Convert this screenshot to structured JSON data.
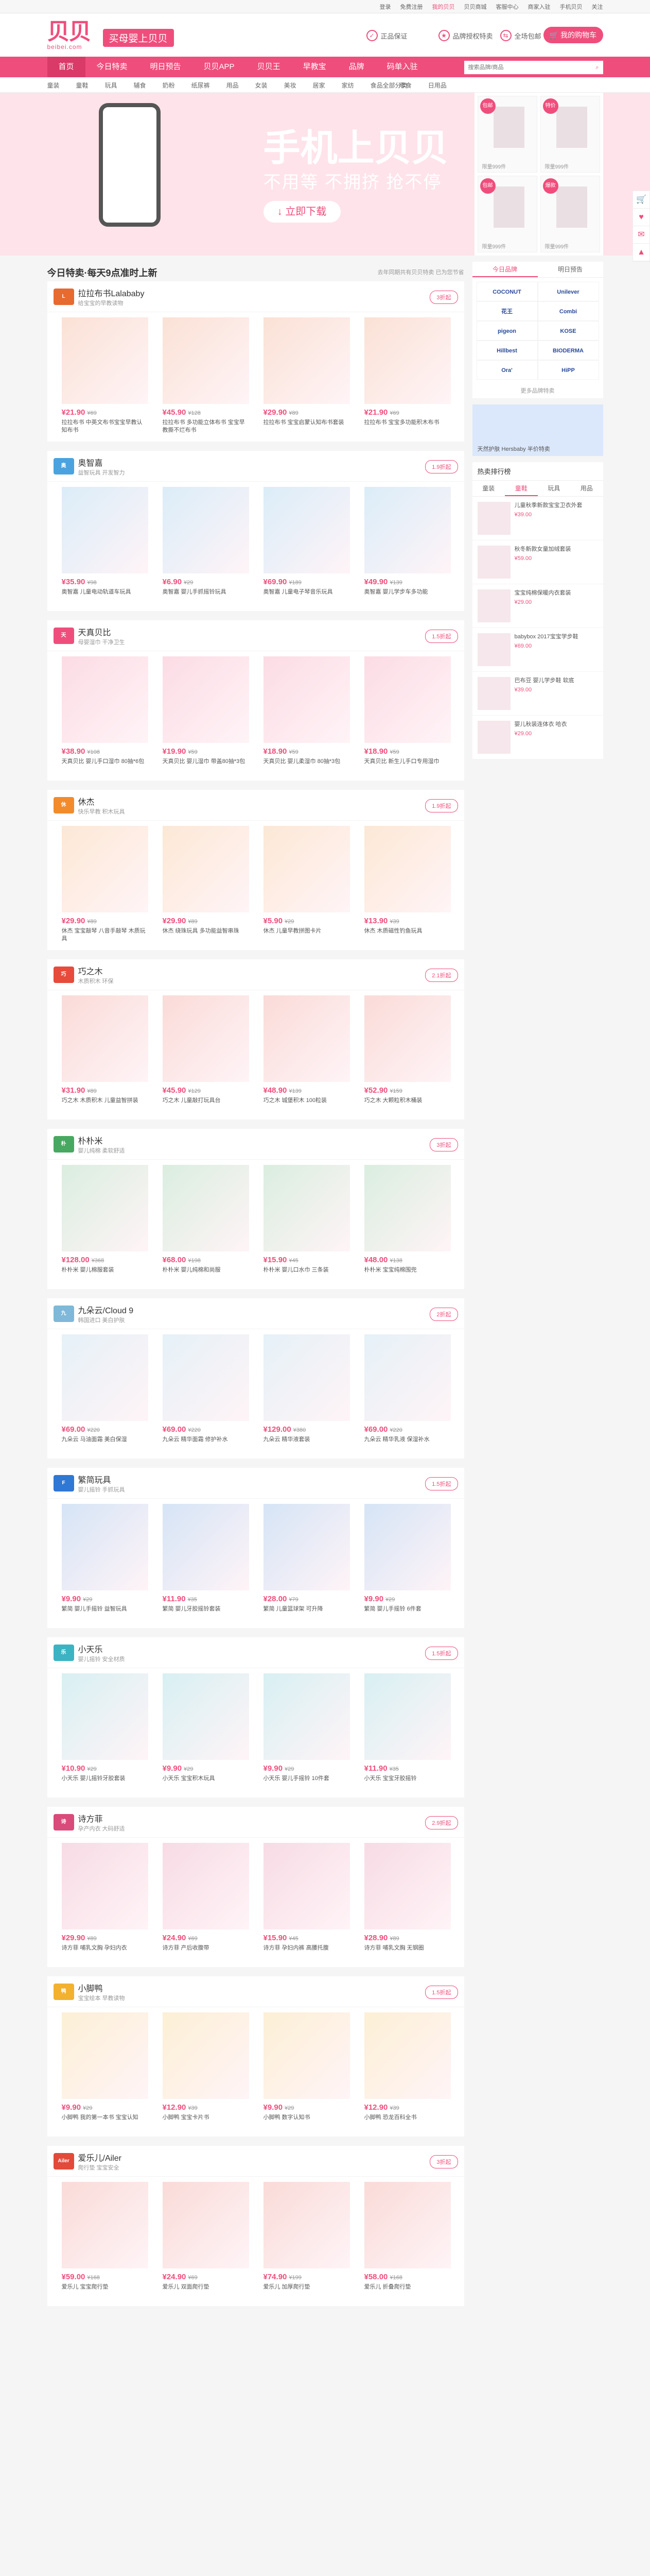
{
  "topbar": {
    "links": [
      "登录",
      "免费注册",
      "我的贝贝",
      "贝贝商城",
      "客服中心",
      "商家入驻",
      "手机贝贝",
      "关注"
    ]
  },
  "header": {
    "logo_text": "贝贝",
    "logo_sub": "beibei.com",
    "slogan": "买母婴上贝贝",
    "guarantees": [
      "正品保证",
      "品牌授权特卖",
      "全场包邮"
    ],
    "cart": "我的购物车",
    "cart_icon": "cart-icon"
  },
  "nav": {
    "items": [
      "首页",
      "今日特卖",
      "明日预告",
      "贝贝APP",
      "贝贝王",
      "早教宝",
      "品牌",
      "码单入驻"
    ],
    "active": 0,
    "search_placeholder": "搜索品牌/商品"
  },
  "categories": {
    "items": [
      "童装",
      "童鞋",
      "玩具",
      "辅食",
      "奶粉",
      "纸尿裤",
      "用品",
      "女装",
      "美妆",
      "居家",
      "家纺",
      "食品",
      "零食",
      "日用品"
    ],
    "right": "全部分类"
  },
  "banner": {
    "title": "手机上贝贝",
    "sub": "不用等 不拥挤 抢不停",
    "button": "立即下载",
    "side": [
      {
        "badge": "包邮",
        "price": "限量999件"
      },
      {
        "badge": "特价",
        "price": "限量999件"
      },
      {
        "badge": "包邮",
        "price": "限量999件"
      },
      {
        "badge": "爆款",
        "price": "限量999件"
      }
    ]
  },
  "section": {
    "title": "今日特卖·每天9点准时上新",
    "note": "去年同期共有贝贝特卖 已为您节省"
  },
  "brands": [
    {
      "name": "拉拉布书Lalababy",
      "sub": "给宝宝的早教读物",
      "btn": "3折起",
      "logo": "L",
      "color": "#e76a2f",
      "products": [
        {
          "p": "¥21.90",
          "o": "¥69",
          "t": "拉拉布书 中英文布书宝宝早教认知布书"
        },
        {
          "p": "¥45.90",
          "o": "¥128",
          "t": "拉拉布书 多功能立体布书 宝宝早教撕不烂布书"
        },
        {
          "p": "¥29.90",
          "o": "¥89",
          "t": "拉拉布书 宝宝启蒙认知布书套装"
        },
        {
          "p": "¥21.90",
          "o": "¥69",
          "t": "拉拉布书 宝宝多功能积木布书"
        }
      ]
    },
    {
      "name": "奥智嘉",
      "sub": "益智玩具 开发智力",
      "btn": "1.9折起",
      "logo": "奥",
      "color": "#4aa3df",
      "products": [
        {
          "p": "¥35.90",
          "o": "¥98",
          "t": "奥智嘉 儿童电动轨道车玩具"
        },
        {
          "p": "¥6.90",
          "o": "¥29",
          "t": "奥智嘉 婴儿手抓摇铃玩具"
        },
        {
          "p": "¥69.90",
          "o": "¥189",
          "t": "奥智嘉 儿童电子琴音乐玩具"
        },
        {
          "p": "¥49.90",
          "o": "¥139",
          "t": "奥智嘉 婴儿学步车多功能"
        }
      ]
    },
    {
      "name": "天真贝比",
      "sub": "母婴湿巾 干净卫生",
      "btn": "1.5折起",
      "logo": "天",
      "color": "#ef4e7c",
      "products": [
        {
          "p": "¥38.90",
          "o": "¥108",
          "t": "天真贝比 婴儿手口湿巾 80抽*6包"
        },
        {
          "p": "¥19.90",
          "o": "¥59",
          "t": "天真贝比 婴儿湿巾 带盖80抽*3包"
        },
        {
          "p": "¥18.90",
          "o": "¥59",
          "t": "天真贝比 婴儿柔湿巾 80抽*3包"
        },
        {
          "p": "¥18.90",
          "o": "¥59",
          "t": "天真贝比 新生儿手口专用湿巾"
        }
      ]
    },
    {
      "name": "休杰",
      "sub": "快乐早教 积木玩具",
      "btn": "1.9折起",
      "logo": "休",
      "color": "#f28b2c",
      "products": [
        {
          "p": "¥29.90",
          "o": "¥89",
          "t": "休杰 宝宝敲琴 八音手敲琴 木质玩具"
        },
        {
          "p": "¥29.90",
          "o": "¥89",
          "t": "休杰 绕珠玩具 多功能益智串珠"
        },
        {
          "p": "¥5.90",
          "o": "¥29",
          "t": "休杰 儿童早教拼图卡片"
        },
        {
          "p": "¥13.90",
          "o": "¥39",
          "t": "休杰 木质磁性钓鱼玩具"
        }
      ]
    },
    {
      "name": "巧之木",
      "sub": "木质积木 环保",
      "btn": "2.1折起",
      "logo": "巧",
      "color": "#e64b3c",
      "products": [
        {
          "p": "¥31.90",
          "o": "¥89",
          "t": "巧之木 木质积木 儿童益智拼装"
        },
        {
          "p": "¥45.90",
          "o": "¥129",
          "t": "巧之木 儿童敲打玩具台"
        },
        {
          "p": "¥48.90",
          "o": "¥139",
          "t": "巧之木 城堡积木 100粒装"
        },
        {
          "p": "¥52.90",
          "o": "¥159",
          "t": "巧之木 大颗粒积木桶装"
        }
      ]
    },
    {
      "name": "朴朴米",
      "sub": "婴儿纯棉 柔软舒适",
      "btn": "3折起",
      "logo": "朴",
      "color": "#48a861",
      "products": [
        {
          "p": "¥128.00",
          "o": "¥368",
          "t": "朴朴米 婴儿棉服套装"
        },
        {
          "p": "¥68.00",
          "o": "¥198",
          "t": "朴朴米 婴儿纯棉和尚服"
        },
        {
          "p": "¥15.90",
          "o": "¥45",
          "t": "朴朴米 婴儿口水巾 三条装"
        },
        {
          "p": "¥48.00",
          "o": "¥138",
          "t": "朴朴米 宝宝纯棉围兜"
        }
      ]
    },
    {
      "name": "九朵云/Cloud 9",
      "sub": "韩国进口 美白护肤",
      "btn": "2折起",
      "logo": "九",
      "color": "#7fb8d9",
      "products": [
        {
          "p": "¥69.00",
          "o": "¥220",
          "t": "九朵云 马油面霜 美白保湿"
        },
        {
          "p": "¥69.00",
          "o": "¥220",
          "t": "九朵云 精华面霜 修护补水"
        },
        {
          "p": "¥129.00",
          "o": "¥380",
          "t": "九朵云 精华液套装"
        },
        {
          "p": "¥69.00",
          "o": "¥220",
          "t": "九朵云 精华乳液 保湿补水"
        }
      ]
    },
    {
      "name": "繁简玩具",
      "sub": "婴儿摇铃 手抓玩具",
      "btn": "1.5折起",
      "logo": "F",
      "color": "#2f78d3",
      "products": [
        {
          "p": "¥9.90",
          "o": "¥29",
          "t": "繁简 婴儿手摇铃 益智玩具"
        },
        {
          "p": "¥11.90",
          "o": "¥35",
          "t": "繁简 婴儿牙胶摇铃套装"
        },
        {
          "p": "¥28.00",
          "o": "¥79",
          "t": "繁简 儿童篮球架 可升降"
        },
        {
          "p": "¥9.90",
          "o": "¥29",
          "t": "繁简 婴儿手摇铃 6件套"
        }
      ]
    },
    {
      "name": "小天乐",
      "sub": "婴儿摇铃 安全材质",
      "btn": "1.5折起",
      "logo": "乐",
      "color": "#3bb3c3",
      "products": [
        {
          "p": "¥10.90",
          "o": "¥29",
          "t": "小天乐 婴儿摇铃牙胶套装"
        },
        {
          "p": "¥9.90",
          "o": "¥29",
          "t": "小天乐 宝宝积木玩具"
        },
        {
          "p": "¥9.90",
          "o": "¥29",
          "t": "小天乐 婴儿手摇铃 10件套"
        },
        {
          "p": "¥11.90",
          "o": "¥35",
          "t": "小天乐 宝宝牙胶摇铃"
        }
      ]
    },
    {
      "name": "诗方菲",
      "sub": "孕产内衣 大码舒适",
      "btn": "2.9折起",
      "logo": "诗",
      "color": "#d94b7a",
      "products": [
        {
          "p": "¥29.90",
          "o": "¥89",
          "t": "诗方菲 哺乳文胸 孕妇内衣"
        },
        {
          "p": "¥24.90",
          "o": "¥69",
          "t": "诗方菲 产后收腹带"
        },
        {
          "p": "¥15.90",
          "o": "¥45",
          "t": "诗方菲 孕妇内裤 高腰托腹"
        },
        {
          "p": "¥28.90",
          "o": "¥89",
          "t": "诗方菲 哺乳文胸 无钢圈"
        }
      ]
    },
    {
      "name": "小脚鸭",
      "sub": "宝宝绘本 早教读物",
      "btn": "1.5折起",
      "logo": "鸭",
      "color": "#f2b12f",
      "products": [
        {
          "p": "¥9.90",
          "o": "¥29",
          "t": "小脚鸭 我的第一本书 宝宝认知"
        },
        {
          "p": "¥12.90",
          "o": "¥39",
          "t": "小脚鸭 宝宝卡片书"
        },
        {
          "p": "¥9.90",
          "o": "¥29",
          "t": "小脚鸭 数字认知书"
        },
        {
          "p": "¥12.90",
          "o": "¥39",
          "t": "小脚鸭 恐龙百科全书"
        }
      ]
    },
    {
      "name": "爱乐儿/Ailer",
      "sub": "爬行垫 宝宝安全",
      "btn": "3折起",
      "logo": "Ailer",
      "color": "#e24a3a",
      "products": [
        {
          "p": "¥59.00",
          "o": "¥168",
          "t": "爱乐儿 宝宝爬行垫"
        },
        {
          "p": "¥24.90",
          "o": "¥69",
          "t": "爱乐儿 双面爬行垫"
        },
        {
          "p": "¥74.90",
          "o": "¥199",
          "t": "爱乐儿 加厚爬行垫"
        },
        {
          "p": "¥58.00",
          "o": "¥168",
          "t": "爱乐儿 折叠爬行垫"
        }
      ]
    }
  ],
  "right": {
    "tabs": [
      "今日品牌",
      "明日预告"
    ],
    "brandlogos": [
      "COCONUT",
      "Unilever",
      "花王",
      "Combi",
      "pigeon",
      "KOSE",
      "Hillbest",
      "BIODERMA",
      "Ora'",
      "HiPP"
    ],
    "more": "更多品牌特卖",
    "ad": "天然护肤 Hersbaby 半价特卖",
    "rank_title": "热卖排行榜",
    "rank_tabs": [
      "童装",
      "童鞋",
      "玩具",
      "用品"
    ],
    "rank": [
      {
        "t": "儿童秋季新款宝宝卫衣外套",
        "p": "¥39.00"
      },
      {
        "t": "秋冬新款女童加绒套装",
        "p": "¥59.00"
      },
      {
        "t": "宝宝纯棉保暖内衣套装",
        "p": "¥29.00"
      },
      {
        "t": "babybox 2017宝宝学步鞋",
        "p": "¥69.00"
      },
      {
        "t": "巴布豆 婴儿学步鞋 软底",
        "p": "¥39.00"
      },
      {
        "t": "婴儿秋装连体衣 哈衣",
        "p": "¥29.00"
      }
    ]
  },
  "float": [
    "cart-icon",
    "heart-icon",
    "message-icon",
    "top-icon"
  ]
}
